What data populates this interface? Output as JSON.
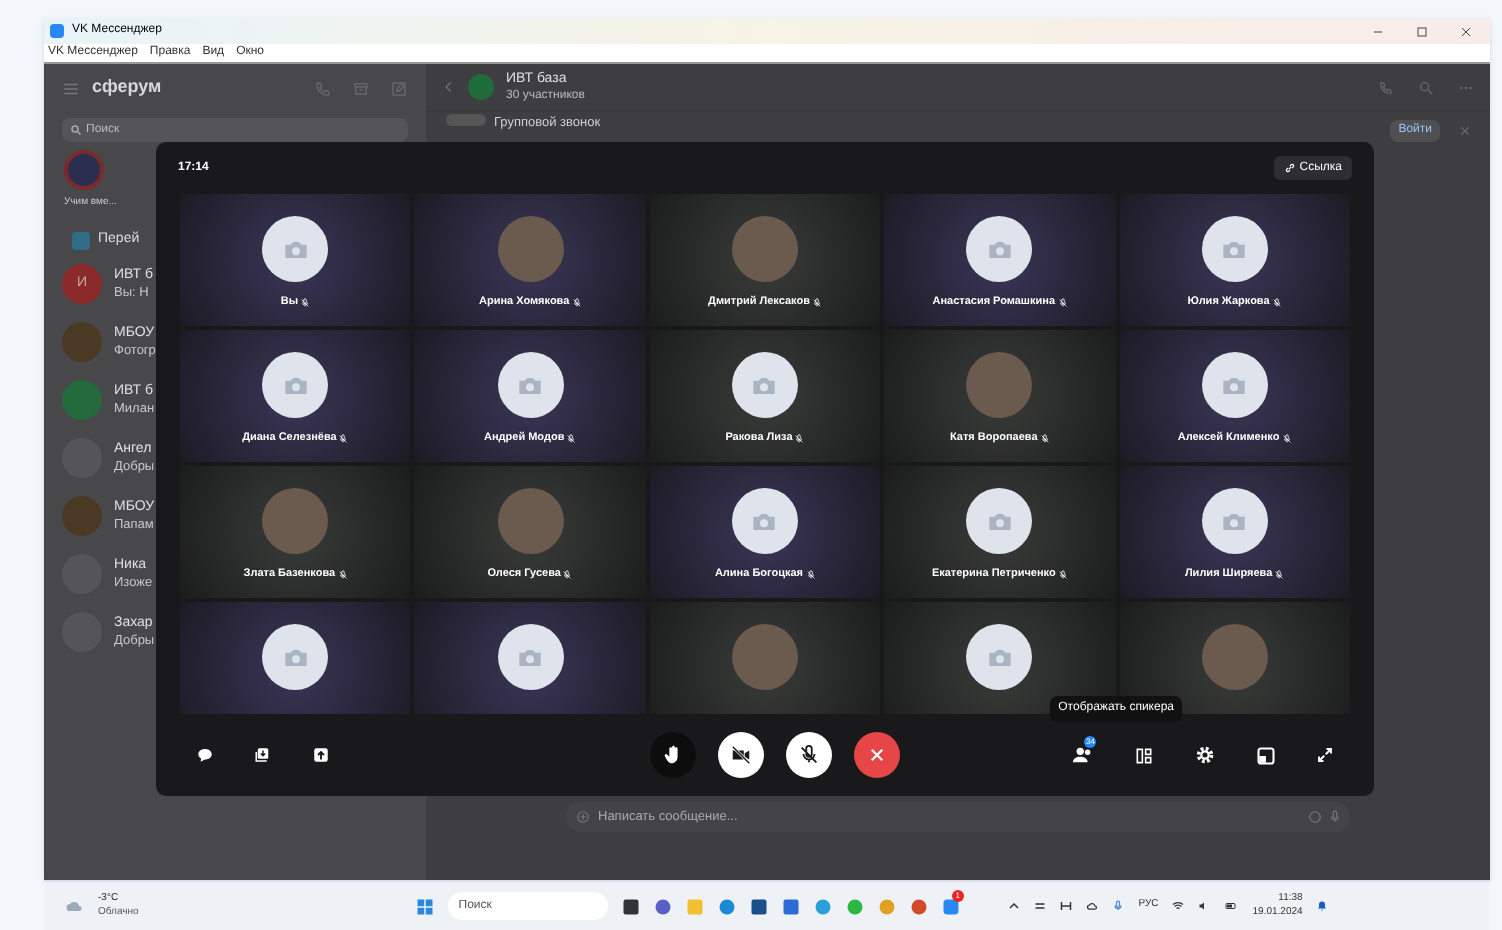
{
  "window": {
    "title": "VK Мессенджер",
    "menu": [
      "VK Мессенджер",
      "Правка",
      "Вид",
      "Окно"
    ]
  },
  "sidebar": {
    "logo": "сферум",
    "search": {
      "placeholder": "Поиск"
    },
    "story": {
      "label": "Учим вме..."
    },
    "promo": "Перей",
    "chats": [
      {
        "kind": "letter",
        "letter": "И",
        "title": "ИВТ б",
        "preview": "Вы: Н"
      },
      {
        "kind": "photo",
        "title": "МБОУ",
        "preview": "Фотогр"
      },
      {
        "kind": "call",
        "title": "ИВТ б",
        "preview": "Милан"
      },
      {
        "kind": "placeholder",
        "title": "Ангел",
        "preview": "Добры"
      },
      {
        "kind": "photo",
        "title": "МБОУ",
        "preview": "Папам"
      },
      {
        "kind": "placeholder",
        "title": "Ника",
        "preview": "Изоже"
      },
      {
        "kind": "placeholder",
        "title": "Захар",
        "preview": "Добры"
      }
    ]
  },
  "chat": {
    "title": "ИВТ база",
    "subtitle": "30 участников",
    "pinned": "Групповой звонок",
    "join": "Войти",
    "message": {
      "placeholder": "Написать сообщение..."
    }
  },
  "call": {
    "time": "17:14",
    "link": "Ссылка",
    "tiles": [
      {
        "name": "Вы",
        "kind": "camera",
        "muted": true
      },
      {
        "name": "Арина Хомякова",
        "kind": "photo",
        "muted": true
      },
      {
        "name": "Дмитрий Лексаков",
        "kind": "photo",
        "muted": true
      },
      {
        "name": "Анастасия Ромашкина",
        "kind": "camera",
        "muted": true
      },
      {
        "name": "Юлия Жаркова",
        "kind": "camera",
        "muted": true
      },
      {
        "name": "Диана Селезнёва",
        "kind": "camera",
        "muted": true
      },
      {
        "name": "Андрей Модов",
        "kind": "camera",
        "muted": true
      },
      {
        "name": "Ракова Лиза",
        "kind": "camera",
        "muted": true
      },
      {
        "name": "Катя Воропаева",
        "kind": "photo",
        "muted": true
      },
      {
        "name": "Алексей Клименко",
        "kind": "camera",
        "muted": true
      },
      {
        "name": "Злата Базенкова",
        "kind": "photo",
        "muted": true
      },
      {
        "name": "Олеся Гусева",
        "kind": "photo",
        "muted": true
      },
      {
        "name": "Алина Богоцкая",
        "kind": "camera",
        "muted": true
      },
      {
        "name": "Екатерина Петриченко",
        "kind": "camera",
        "muted": true
      },
      {
        "name": "Лилия Ширяева",
        "kind": "camera",
        "muted": true
      },
      {
        "kind": "camera"
      },
      {
        "kind": "camera"
      },
      {
        "kind": "photo"
      },
      {
        "kind": "camera"
      },
      {
        "kind": "photo"
      }
    ],
    "participants_count": "34",
    "tooltip": "Отображать спикера"
  },
  "taskbar": {
    "weather": {
      "temp": "-3°C",
      "text": "Облачно"
    },
    "search": {
      "placeholder": "Поиск"
    },
    "language": "РУС",
    "time": "11:38",
    "date": "19.01.2024",
    "messenger_badge": "1"
  }
}
